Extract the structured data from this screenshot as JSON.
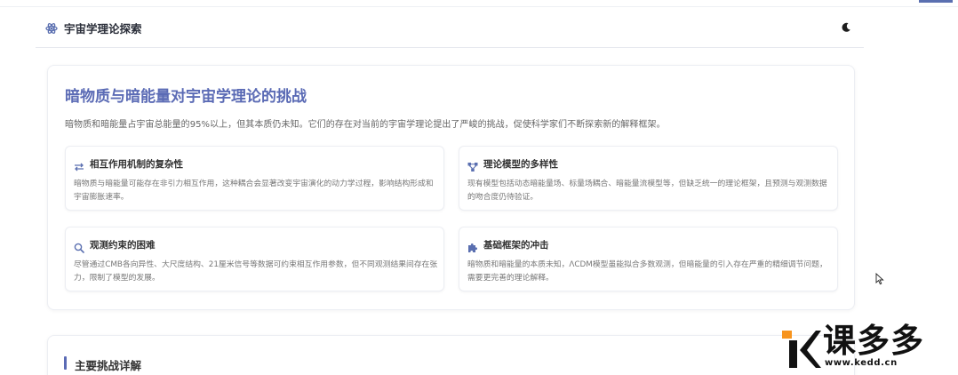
{
  "header": {
    "title": "宇宙学理论探索",
    "icon": "atom-icon",
    "theme_toggle_icon": "moon-icon"
  },
  "intro_card": {
    "title": "暗物质与暗能量对宇宙学理论的挑战",
    "description": "暗物质和暗能量占宇宙总能量的95%以上，但其本质仍未知。它们的存在对当前的宇宙学理论提出了严峻的挑战，促使科学家们不断探索新的解释框架。",
    "features": [
      {
        "icon": "arrows-exchange-icon",
        "title": "相互作用机制的复杂性",
        "text": "暗物质与暗能量可能存在非引力相互作用，这种耦合会显著改变宇宙演化的动力学过程，影响结构形成和宇宙膨胀速率。"
      },
      {
        "icon": "network-nodes-icon",
        "title": "理论模型的多样性",
        "text": "现有模型包括动态暗能量场、标量场耦合、暗能量流模型等，但缺乏统一的理论框架，且预测与观测数据的吻合度仍待验证。"
      },
      {
        "icon": "magnifier-icon",
        "title": "观测约束的困难",
        "text": "尽管通过CMB各向异性、大尺度结构、21厘米信号等数据可约束相互作用参数，但不同观测结果间存在张力，限制了模型的发展。"
      },
      {
        "icon": "puzzle-icon",
        "title": "基础框架的冲击",
        "text": "暗物质和暗能量的本质未知，ΛCDM模型虽能拟合多数观测，但暗能量的引入存在严重的精细调节问题，需要更完善的理论解释。"
      }
    ]
  },
  "details_card": {
    "title": "主要挑战详解"
  },
  "watermark": {
    "brand": "课多多",
    "url": "www.kedd.cn",
    "accent_color": "#f7941d"
  },
  "colors": {
    "accent": "#5b6bb5",
    "icon": "#5a6fb0"
  }
}
